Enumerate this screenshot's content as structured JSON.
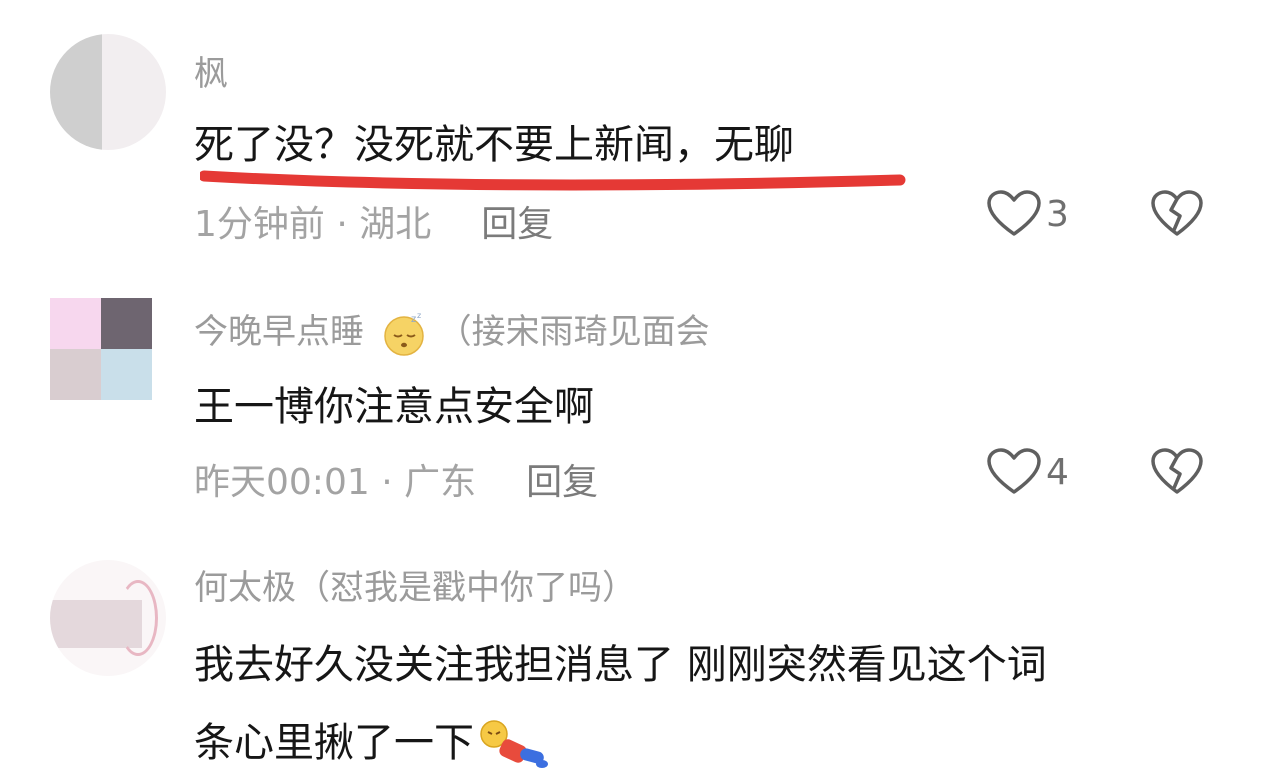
{
  "comments": [
    {
      "author": "枫",
      "text": "死了没？没死就不要上新闻，无聊",
      "time_location": "1分钟前 · 湖北",
      "reply_label": "回复",
      "likes": "3",
      "highlight_color": "#e53935"
    },
    {
      "author": "今晚早点睡",
      "author_suffix": "（接宋雨琦见面会",
      "author_emoji": "sleeping-face-icon",
      "text": "王一博你注意点安全啊",
      "time_location": "昨天00:01 · 广东",
      "reply_label": "回复",
      "likes": "4",
      "avatar_colors": [
        "#f7d7ee",
        "#6e6570",
        "#d9cdd0",
        "#c9dfea"
      ]
    },
    {
      "author": "何太极（怼我是戳中你了吗）",
      "text_line1": "我去好久没关注我担消息了 刚刚突然看见这个词",
      "text_line2": "条心里揪了一下",
      "text_emoji": "fallen-person-icon"
    }
  ]
}
